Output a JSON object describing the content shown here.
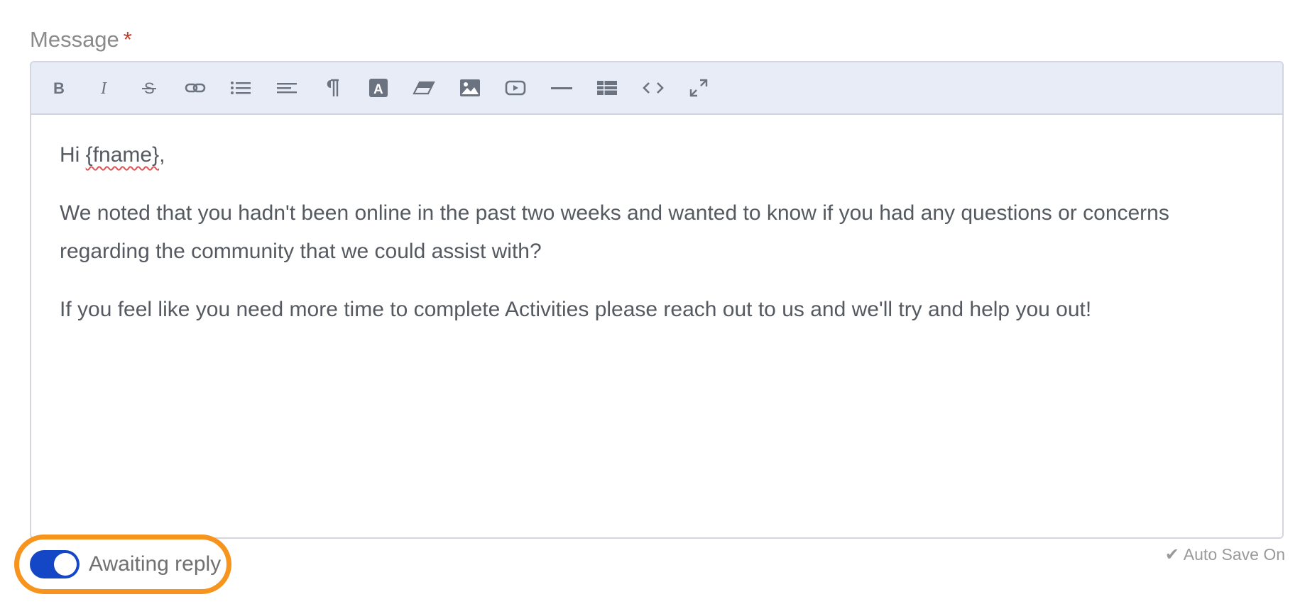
{
  "field": {
    "label": "Message",
    "required_marker": "*"
  },
  "toolbar": {
    "tools": [
      {
        "name": "bold",
        "icon": "bold-icon"
      },
      {
        "name": "italic",
        "icon": "italic-icon"
      },
      {
        "name": "strikethrough",
        "icon": "strikethrough-icon"
      },
      {
        "name": "link",
        "icon": "link-icon"
      },
      {
        "name": "bulleted-list",
        "icon": "list-icon"
      },
      {
        "name": "align",
        "icon": "align-left-icon"
      },
      {
        "name": "paragraph",
        "icon": "paragraph-icon"
      },
      {
        "name": "text-color",
        "icon": "font-color-icon"
      },
      {
        "name": "clear-formatting",
        "icon": "eraser-icon"
      },
      {
        "name": "insert-image",
        "icon": "image-icon"
      },
      {
        "name": "insert-video",
        "icon": "video-icon"
      },
      {
        "name": "horizontal-rule",
        "icon": "horizontal-rule-icon"
      },
      {
        "name": "insert-table",
        "icon": "table-icon"
      },
      {
        "name": "code-view",
        "icon": "code-icon"
      },
      {
        "name": "fullscreen",
        "icon": "expand-icon"
      }
    ]
  },
  "editor": {
    "greeting_prefix": "Hi ",
    "greeting_token": "{fname}",
    "greeting_suffix": ",",
    "paragraph_1": "We noted that you hadn't been online in the past two weeks and wanted to know if you had any questions or concerns regarding the community that we could assist with?",
    "paragraph_2": "If you feel like you need more time to complete Activities please reach out to us and we'll try and help you out!"
  },
  "awaiting_reply": {
    "label": "Awaiting reply",
    "enabled": true,
    "toggle_color": "#1447c6",
    "highlight_color": "#f7941d"
  },
  "autosave": {
    "icon": "check-icon",
    "label": "Auto Save On"
  }
}
